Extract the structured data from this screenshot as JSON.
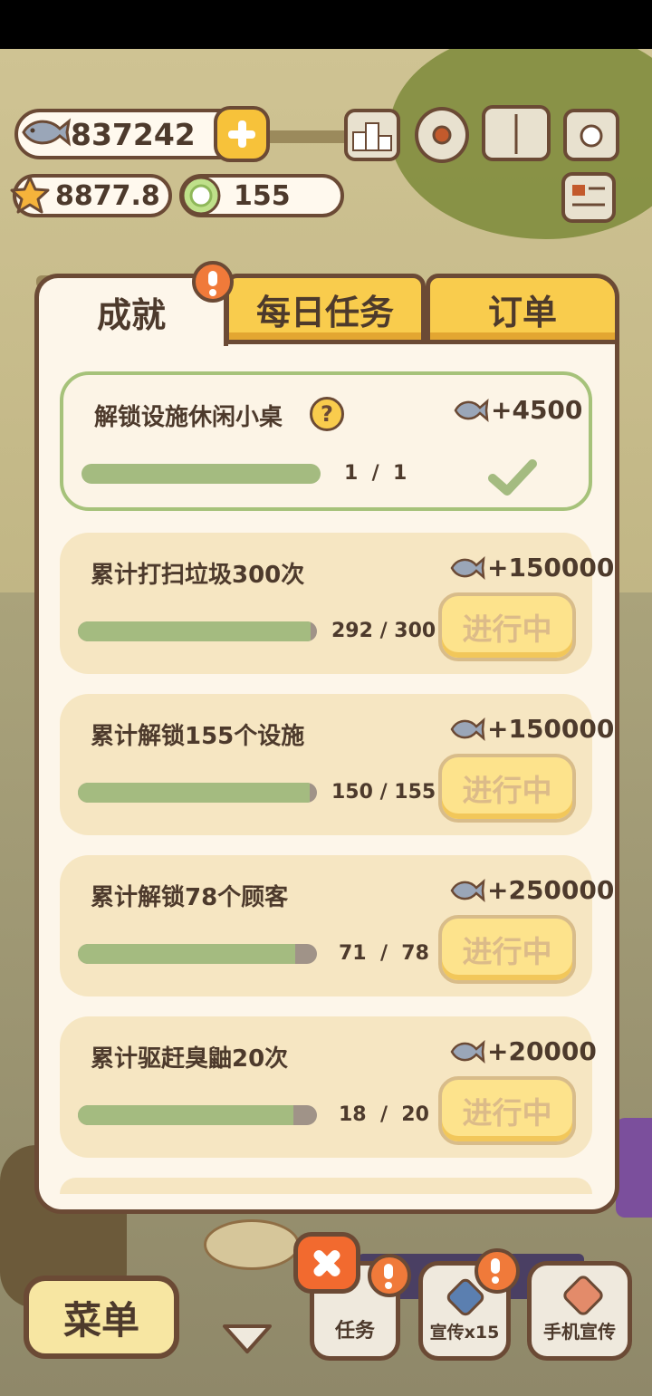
{
  "hud": {
    "fish": "837242",
    "stars": "8877.8",
    "coins": "155"
  },
  "tabs": [
    {
      "label": "成就",
      "active": true
    },
    {
      "label": "每日任务",
      "active": false
    },
    {
      "label": "订单",
      "active": false
    }
  ],
  "tasks": [
    {
      "title": "解锁设施休闲小桌",
      "reward": "+4500",
      "current": "1",
      "total": "1",
      "progress": 1.0,
      "status": "done"
    },
    {
      "title": "累计打扫垃圾300次",
      "reward": "+150000",
      "current": "292",
      "total": "300",
      "progress": 0.973,
      "status": "进行中"
    },
    {
      "title": "累计解锁155个设施",
      "reward": "+150000",
      "current": "150",
      "total": "155",
      "progress": 0.968,
      "status": "进行中"
    },
    {
      "title": "累计解锁78个顾客",
      "reward": "+250000",
      "current": "71",
      "total": "78",
      "progress": 0.91,
      "status": "进行中"
    },
    {
      "title": "累计驱赶臭鼬20次",
      "reward": "+20000",
      "current": "18",
      "total": "20",
      "progress": 0.9,
      "status": "进行中"
    }
  ],
  "bottom": {
    "menu": "菜单",
    "task": "任务",
    "promo": "宣传x15",
    "phone_promo": "手机宣传"
  },
  "colors": {
    "outline": "#6b4a35",
    "tab_yellow": "#f9cc4d",
    "progress_green": "#a4bb80",
    "badge_orange": "#f07a3a",
    "close_red": "#f26a2f"
  }
}
